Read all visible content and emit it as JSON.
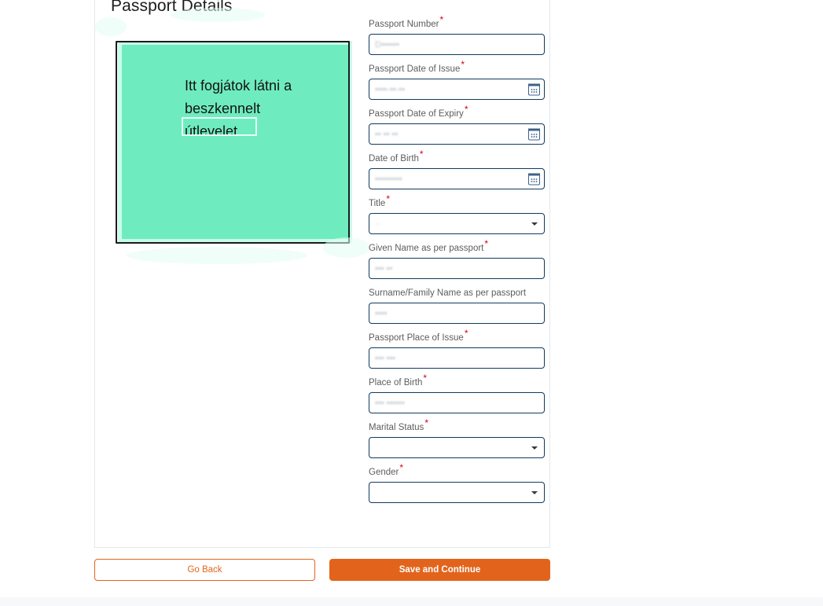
{
  "page": {
    "title": "Passport Details",
    "background_color": "#ffffff",
    "card_border_color": "#e3e8ee"
  },
  "scan_preview": {
    "name": "scanned-passport-preview",
    "placeholder_color": "#6eecc0",
    "glow_color": "#c9fbec",
    "frame_color": "#1b1b1b",
    "text": "Itt fogjátok látni a beszkennelt útlevelet."
  },
  "form": {
    "required_marker": "*",
    "required_marker_color": "#d0021b",
    "label_color": "#5d5d5d",
    "input_border_color": "#123a5e",
    "fields": [
      {
        "name": "passport-number",
        "label": "Passport Number",
        "required": true,
        "type": "text",
        "value": "",
        "placeholder": ""
      },
      {
        "name": "passport-date-of-issue",
        "label": "Passport Date of Issue",
        "required": true,
        "type": "date",
        "value": "",
        "placeholder": "",
        "icon": "calendar-icon"
      },
      {
        "name": "passport-date-of-expiry",
        "label": "Passport Date of Expiry",
        "required": true,
        "type": "date",
        "value": "",
        "placeholder": "",
        "icon": "calendar-icon"
      },
      {
        "name": "date-of-birth",
        "label": "Date of Birth",
        "required": true,
        "type": "date",
        "value": "",
        "placeholder": "",
        "icon": "calendar-icon"
      },
      {
        "name": "title",
        "label": "Title",
        "required": true,
        "type": "select",
        "value": "",
        "icon": "chevron-down-icon"
      },
      {
        "name": "given-name",
        "label": "Given Name as per passport",
        "required": true,
        "type": "text",
        "value": "",
        "placeholder": ""
      },
      {
        "name": "surname-family-name",
        "label": "Surname/Family Name as per passport",
        "required": false,
        "type": "text",
        "value": "",
        "placeholder": ""
      },
      {
        "name": "passport-place-of-issue",
        "label": "Passport Place of Issue",
        "required": true,
        "type": "text",
        "value": "",
        "placeholder": ""
      },
      {
        "name": "place-of-birth",
        "label": "Place of Birth",
        "required": true,
        "type": "text",
        "value": "",
        "placeholder": ""
      },
      {
        "name": "marital-status",
        "label": "Marital Status",
        "required": true,
        "type": "select",
        "value": "",
        "icon": "chevron-down-icon"
      },
      {
        "name": "gender",
        "label": "Gender",
        "required": true,
        "type": "select",
        "value": "",
        "icon": "chevron-down-icon"
      }
    ]
  },
  "footer": {
    "go_back_label": "Go Back",
    "save_and_continue_label": "Save and Continue",
    "primary_color": "#e2641c",
    "strip_text": ""
  }
}
